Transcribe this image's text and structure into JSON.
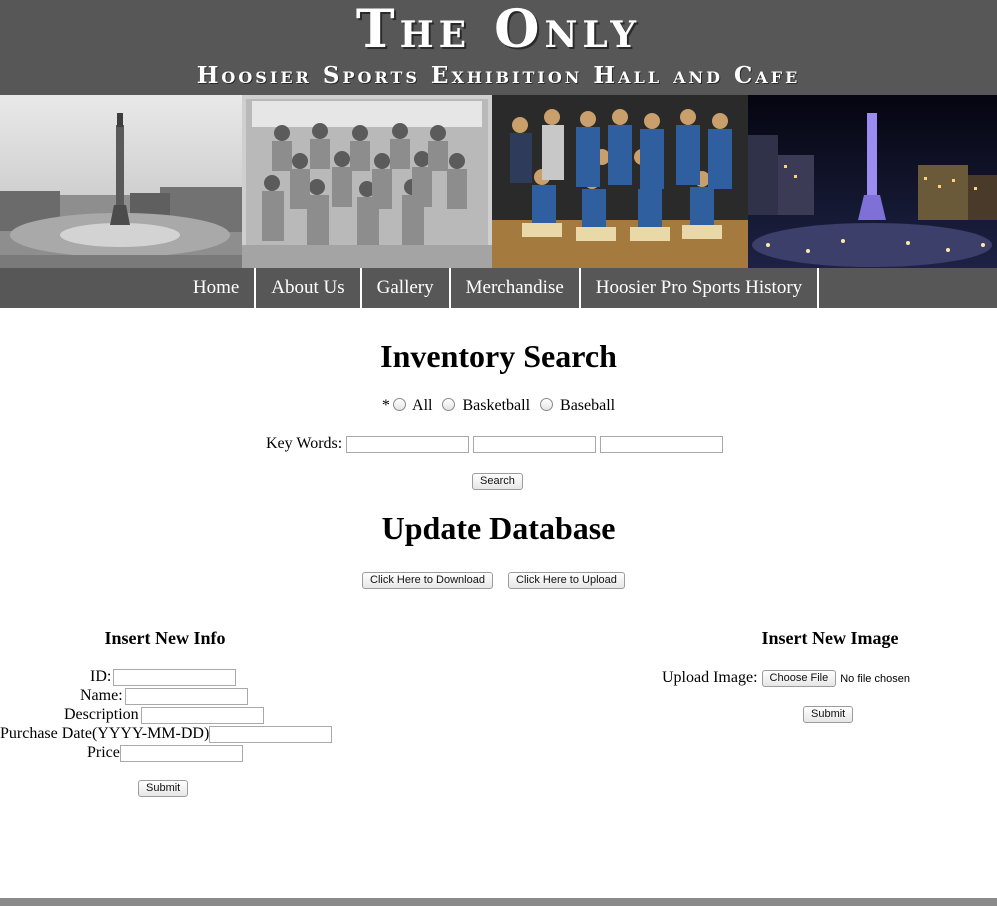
{
  "header": {
    "title": "The Only",
    "subtitle": "Hoosier Sports Exhibition Hall and Cafe"
  },
  "nav": {
    "items": [
      "Home",
      "About Us",
      "Gallery",
      "Merchandise",
      "Hoosier Pro Sports History"
    ]
  },
  "search": {
    "heading": "Inventory Search",
    "required_mark": "*",
    "radios": [
      "All",
      "Basketball",
      "Baseball"
    ],
    "keywords_label": "Key Words:",
    "keyword_values": [
      "",
      "",
      ""
    ],
    "search_button": "Search"
  },
  "update": {
    "heading": "Update Database",
    "download_button": "Click Here to Download",
    "upload_button": "Click Here to Upload"
  },
  "insert_info": {
    "heading": "Insert New Info",
    "id_label": "ID:",
    "name_label": "Name:",
    "description_label": "Description",
    "purchase_date_label": "Purchase Date(YYYY-MM-DD)",
    "price_label": "Price",
    "submit_button": "Submit"
  },
  "insert_image": {
    "heading": "Insert New Image",
    "upload_label": "Upload Image:",
    "choose_file_button": "Choose File",
    "file_status": "No file chosen",
    "submit_button": "Submit"
  },
  "colors": {
    "banner_bg": "#575757",
    "nav_bg": "#575757",
    "footer": "#8a8a8a"
  }
}
